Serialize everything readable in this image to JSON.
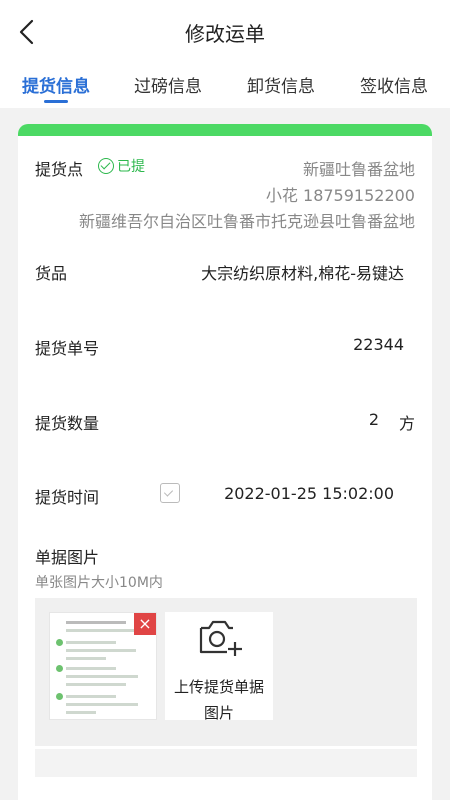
{
  "header": {
    "title": "修改运单",
    "back_icon": "chevron-left-icon"
  },
  "tabs": [
    {
      "label": "提货信息",
      "active": true
    },
    {
      "label": "过磅信息",
      "active": false
    },
    {
      "label": "卸货信息",
      "active": false
    },
    {
      "label": "签收信息",
      "active": false
    }
  ],
  "pickup": {
    "point_label": "提货点",
    "status": "已提",
    "location": "新疆吐鲁番盆地",
    "contact": "小花 18759152200",
    "address": "新疆维吾尔自治区吐鲁番市托克逊县吐鲁番盆地",
    "goods_label": "货品",
    "goods_value": "大宗纺织原材料,棉花-易键达",
    "order_no_label": "提货单号",
    "order_no_value": "22344",
    "qty_label": "提货数量",
    "qty_value": "2",
    "qty_unit": "方",
    "time_label": "提货时间",
    "time_value": "2022-01-25 15:02:00",
    "images_label": "单据图片",
    "images_hint": "单张图片大小10M内",
    "upload_label_1": "上传提货单据",
    "upload_label_2": "图片",
    "delete_symbol": "×"
  },
  "colors": {
    "accent": "#2a6fd6",
    "success": "#4cd964",
    "status_green": "#2db84d",
    "delete_red": "#e04545"
  }
}
